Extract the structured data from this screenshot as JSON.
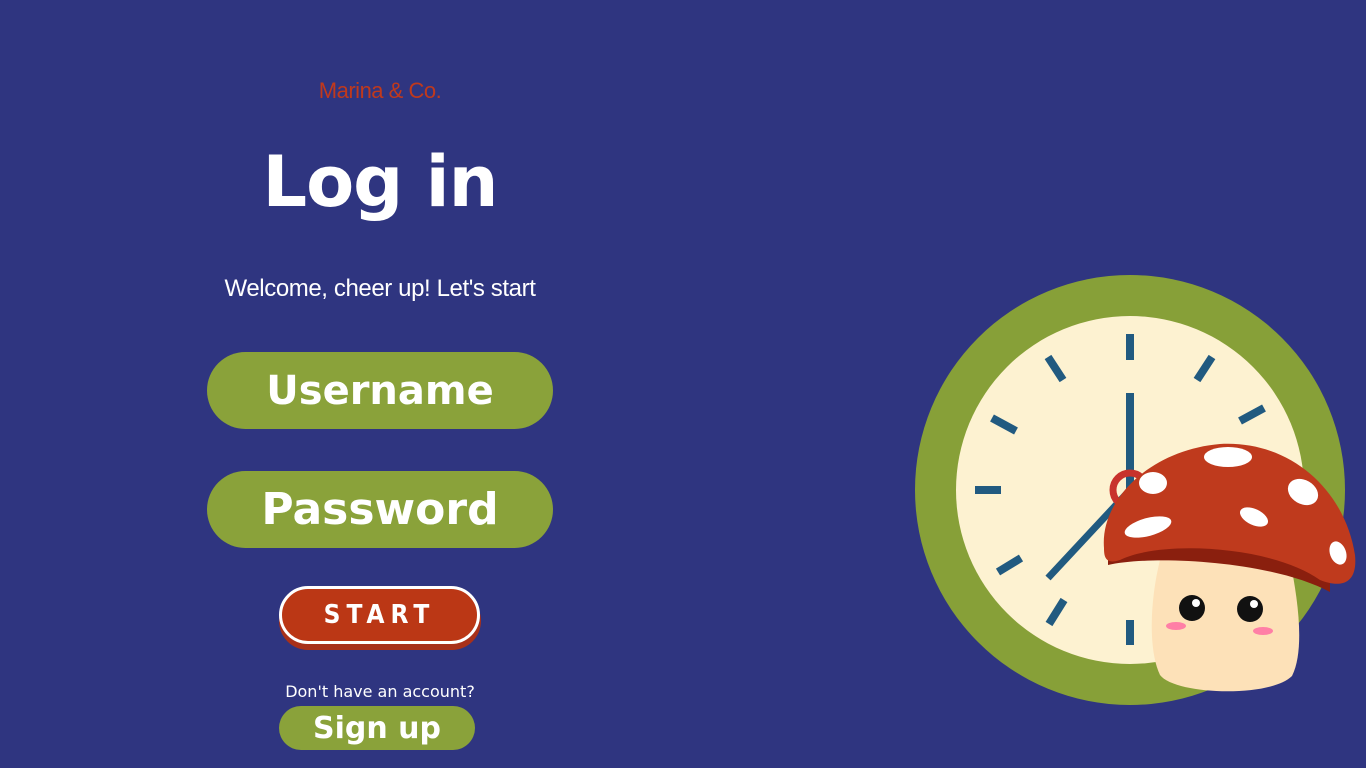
{
  "brand": "Marina & Co.",
  "title": "Log in",
  "subtitle": "Welcome, cheer up! Let's start",
  "username_label": "Username",
  "password_label": "Password",
  "start_label": "START",
  "signup_prompt": "Don't have an account?",
  "signup_label": "Sign up",
  "colors": {
    "background": "#2f3580",
    "pill_green": "#8aa23a",
    "start_red": "#bb3715",
    "brand_red": "#c0391c"
  },
  "illustration": {
    "clock_icon": "clock-icon",
    "mascot_icon": "mushroom-mascot-icon"
  }
}
